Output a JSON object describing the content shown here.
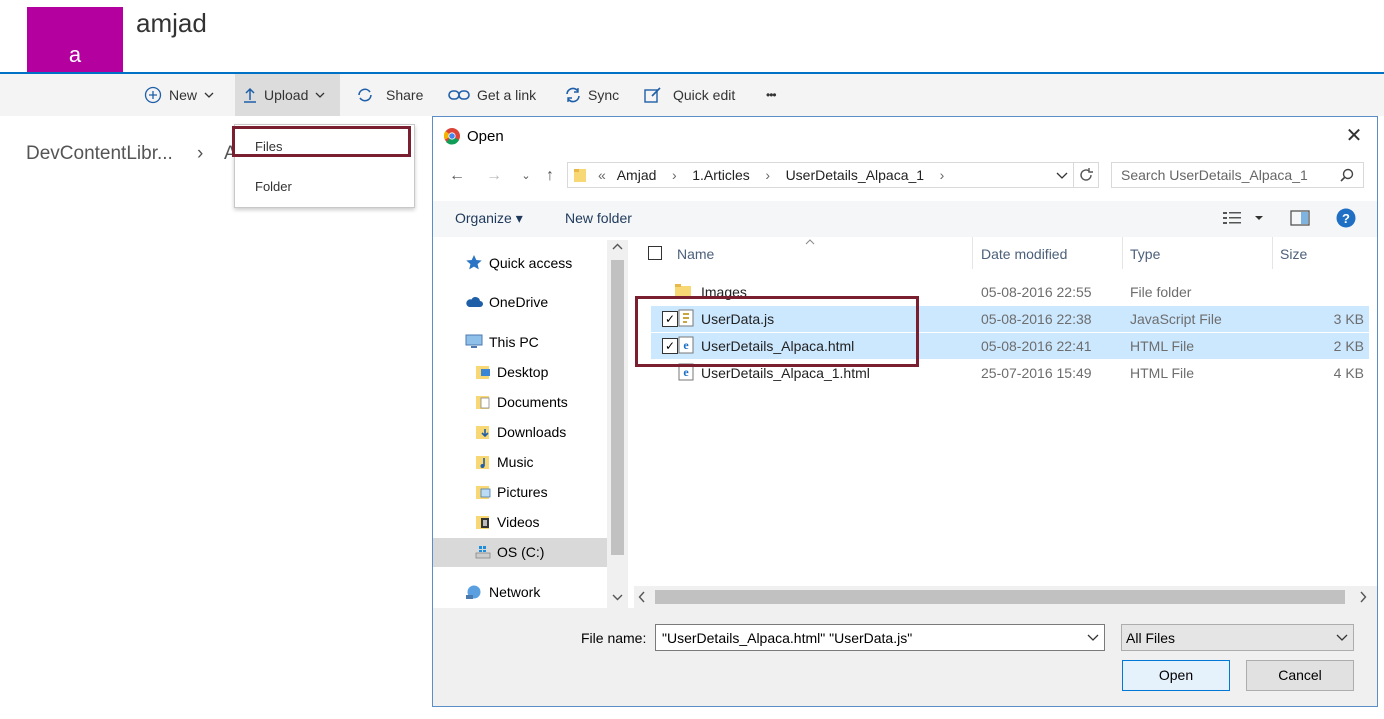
{
  "site": {
    "avatar_letter": "a",
    "title": "amjad"
  },
  "commands": {
    "new": "New",
    "upload": "Upload",
    "share": "Share",
    "get_link": "Get a link",
    "sync": "Sync",
    "quick_edit": "Quick edit",
    "more": "•••"
  },
  "breadcrumb": {
    "library": "DevContentLibr...",
    "separator": "›",
    "next": "A"
  },
  "upload_menu": {
    "items": [
      "Files",
      "Folder"
    ]
  },
  "dialog": {
    "title": "Open",
    "close": "✕",
    "address": {
      "prefix": "«",
      "segments": [
        "Amjad",
        "1.Articles",
        "UserDetails_Alpaca_1"
      ],
      "sep": "›"
    },
    "search_placeholder": "Search UserDetails_Alpaca_1",
    "organize": "Organize ▾",
    "new_folder": "New folder",
    "nav": [
      "Quick access",
      "OneDrive",
      "This PC",
      "Desktop",
      "Documents",
      "Downloads",
      "Music",
      "Pictures",
      "Videos",
      "OS (C:)",
      "Network"
    ],
    "columns": {
      "name": "Name",
      "date": "Date modified",
      "type": "Type",
      "size": "Size"
    },
    "files": [
      {
        "name": "Images",
        "date": "05-08-2016 22:55",
        "type": "File folder",
        "size": ""
      },
      {
        "name": "UserData.js",
        "date": "05-08-2016 22:38",
        "type": "JavaScript File",
        "size": "3 KB"
      },
      {
        "name": "UserDetails_Alpaca.html",
        "date": "05-08-2016 22:41",
        "type": "HTML File",
        "size": "2 KB"
      },
      {
        "name": "UserDetails_Alpaca_1.html",
        "date": "25-07-2016 15:49",
        "type": "HTML File",
        "size": "4 KB"
      }
    ],
    "file_name_label": "File name:",
    "file_name_value": "\"UserDetails_Alpaca.html\" \"UserData.js\"",
    "file_type": "All Files",
    "open_button": "Open",
    "cancel_button": "Cancel"
  },
  "colors": {
    "accent": "#0072c6",
    "avatar": "#b4009e",
    "highlight_box": "#7a1f30",
    "selection": "#cce8ff"
  }
}
